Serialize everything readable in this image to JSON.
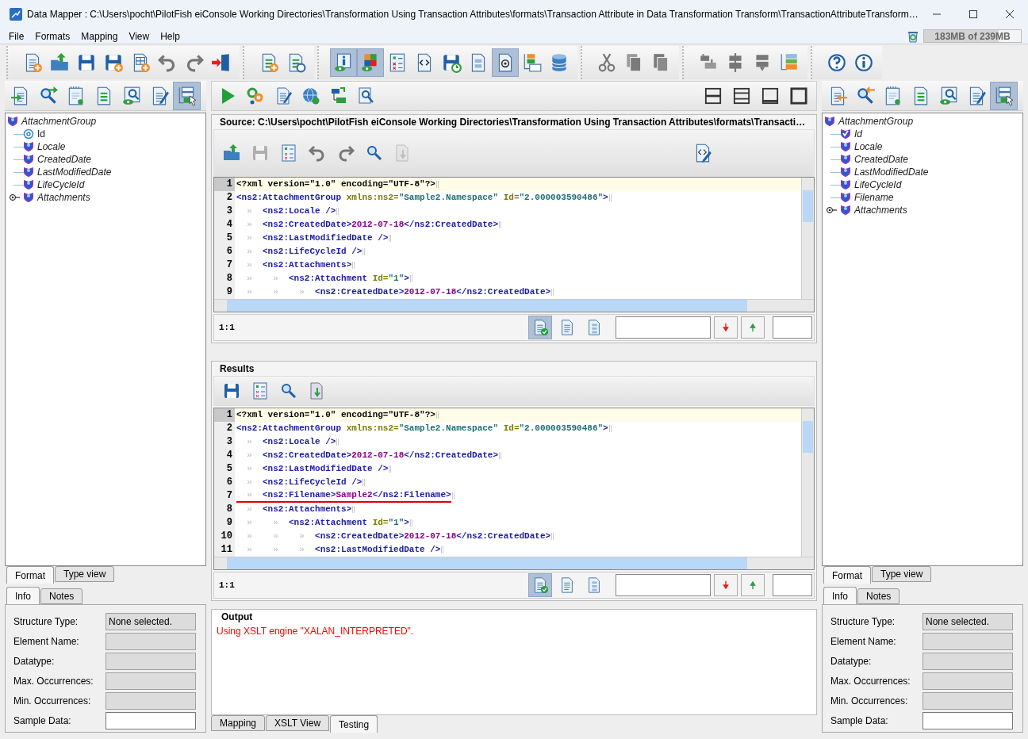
{
  "window": {
    "title": "Data Mapper : C:\\Users\\pocht\\PilotFish eiConsole Working Directories\\Transformation Using Transaction Attributes\\formats\\Transaction Attribute in Data Transformation Transform\\TransactionAttributeTransform…"
  },
  "menu": [
    "File",
    "Formats",
    "Mapping",
    "View",
    "Help"
  ],
  "memory": {
    "text": "183MB of 239MB",
    "level": 0.77
  },
  "main_toolbar": [
    [
      {
        "kind": "addfile",
        "pressed": false
      },
      {
        "kind": "openfolder",
        "pressed": false
      },
      {
        "kind": "save",
        "pressed": false
      },
      {
        "kind": "saveplus",
        "pressed": false
      },
      {
        "kind": "xls",
        "pressed": false
      },
      {
        "kind": "undo",
        "pressed": false
      },
      {
        "kind": "redo",
        "pressed": false
      },
      {
        "kind": "exit",
        "pressed": false
      }
    ],
    [
      {
        "kind": "listplus",
        "pressed": false
      },
      {
        "kind": "listgear",
        "pressed": false
      }
    ],
    [
      {
        "kind": "infoeye",
        "pressed": true
      },
      {
        "kind": "gridview",
        "pressed": true
      },
      {
        "kind": "checklist",
        "pressed": false
      },
      {
        "kind": "codedoc",
        "pressed": false
      },
      {
        "kind": "saveclock",
        "pressed": false
      },
      {
        "kind": "calcdoc",
        "pressed": false
      },
      {
        "kind": "atdoc",
        "pressed": true
      },
      {
        "kind": "treetable",
        "pressed": false
      },
      {
        "kind": "database",
        "pressed": false
      }
    ],
    [
      {
        "kind": "scissors",
        "pressed": false
      },
      {
        "kind": "copy",
        "pressed": false
      },
      {
        "kind": "paste",
        "pressed": false
      }
    ],
    [
      {
        "kind": "stackup",
        "pressed": false
      },
      {
        "kind": "stackmid",
        "pressed": false
      },
      {
        "kind": "stackdown",
        "pressed": false
      },
      {
        "kind": "colorstack",
        "pressed": false
      }
    ],
    [
      {
        "kind": "help",
        "pressed": false
      },
      {
        "kind": "info",
        "pressed": false
      }
    ]
  ],
  "left_panel": {
    "toolbar": [
      {
        "kind": "importdoc",
        "pressed": false
      },
      {
        "kind": "findmove",
        "pressed": false
      },
      {
        "kind": "notepad",
        "pressed": false
      },
      {
        "kind": "listdoc",
        "pressed": false
      },
      {
        "kind": "eyesearch",
        "pressed": false
      },
      {
        "kind": "editdoc",
        "pressed": false
      },
      {
        "kind": "treecursor",
        "pressed": true
      }
    ],
    "tree": {
      "label": "AttachmentGroup",
      "kind": "element",
      "children": [
        {
          "label": "Id",
          "kind": "attribute"
        },
        {
          "label": "Locale",
          "kind": "element"
        },
        {
          "label": "CreatedDate",
          "kind": "element"
        },
        {
          "label": "LastModifiedDate",
          "kind": "element"
        },
        {
          "label": "LifeCycleId",
          "kind": "element"
        },
        {
          "label": "Attachments",
          "kind": "element",
          "expanded": false
        }
      ]
    },
    "view_tabs": [
      {
        "label": "Format",
        "selected": true
      },
      {
        "label": "Type view",
        "selected": false
      }
    ],
    "info_tabs": [
      {
        "label": "Info",
        "selected": true
      },
      {
        "label": "Notes",
        "selected": false
      }
    ],
    "fields": [
      {
        "label": "Structure Type:",
        "value": "None selected.",
        "disabled": true
      },
      {
        "label": "Element Name:",
        "disabled": true
      },
      {
        "label": "Datatype:",
        "disabled": true
      },
      {
        "label": "Max. Occurrences:",
        "disabled": true
      },
      {
        "label": "Min. Occurrences:",
        "disabled": true
      },
      {
        "label": "Sample Data:",
        "disabled": false
      }
    ]
  },
  "center": {
    "toolbar": [
      {
        "kind": "play",
        "pressed": false
      },
      {
        "kind": "gears",
        "pressed": false
      },
      {
        "kind": "editdoc",
        "pressed": false
      },
      {
        "kind": "globe",
        "pressed": false
      },
      {
        "kind": "treearrow",
        "pressed": false
      },
      {
        "kind": "searchdoc",
        "pressed": false
      }
    ],
    "layout_toolbar": [
      {
        "kind": "splith",
        "pressed": false
      },
      {
        "kind": "splitrows",
        "pressed": false
      },
      {
        "kind": "framebottom",
        "pressed": false
      },
      {
        "kind": "framefull",
        "pressed": false
      }
    ],
    "source": {
      "title": "Source: C:\\Users\\pocht\\PilotFish eiConsole Working Directories\\Transformation Using Transaction Attributes\\formats\\Transacti…",
      "toolbar": [
        {
          "kind": "openfolder",
          "disabled": false
        },
        {
          "kind": "save",
          "disabled": true
        },
        {
          "kind": "checklist",
          "disabled": false
        },
        {
          "kind": "undo",
          "disabled": false
        },
        {
          "kind": "redo",
          "disabled": false
        },
        {
          "kind": "search",
          "disabled": false
        },
        {
          "kind": "docdown",
          "disabled": true
        }
      ],
      "lines": [
        {
          "number": "1",
          "current": true,
          "tokens": [
            {
              "kind": "pi",
              "text": "<?xml version=\"1.0\" encoding=\"UTF-8\"?>"
            }
          ]
        },
        {
          "number": "2",
          "current": false,
          "tokens": [
            {
              "kind": "tag",
              "text": "<ns2:AttachmentGroup"
            },
            {
              "kind": "attr",
              "text": " xmlns:ns2="
            },
            {
              "kind": "val",
              "text": "\"Sample2.Namespace\""
            },
            {
              "kind": "attr",
              "text": " Id="
            },
            {
              "kind": "val",
              "text": "\"2.000003590486\""
            },
            {
              "kind": "tag",
              "text": ">"
            }
          ]
        },
        {
          "number": "3",
          "current": false,
          "tokens": [
            {
              "kind": "ws",
              "text": "  »  "
            },
            {
              "kind": "tag",
              "text": "<ns2:Locale />"
            }
          ]
        },
        {
          "number": "4",
          "current": false,
          "tokens": [
            {
              "kind": "ws",
              "text": "  »  "
            },
            {
              "kind": "tag",
              "text": "<ns2:CreatedDate>"
            },
            {
              "kind": "text",
              "text": "2012-07-18"
            },
            {
              "kind": "tag",
              "text": "</ns2:CreatedDate>"
            }
          ]
        },
        {
          "number": "5",
          "current": false,
          "tokens": [
            {
              "kind": "ws",
              "text": "  »  "
            },
            {
              "kind": "tag",
              "text": "<ns2:LastModifiedDate />"
            }
          ]
        },
        {
          "number": "6",
          "current": false,
          "tokens": [
            {
              "kind": "ws",
              "text": "  »  "
            },
            {
              "kind": "tag",
              "text": "<ns2:LifeCycleId />"
            }
          ]
        },
        {
          "number": "7",
          "current": false,
          "tokens": [
            {
              "kind": "ws",
              "text": "  »  "
            },
            {
              "kind": "tag",
              "text": "<ns2:Attachments>"
            }
          ]
        },
        {
          "number": "8",
          "current": false,
          "tokens": [
            {
              "kind": "ws",
              "text": "  »    »  "
            },
            {
              "kind": "tag",
              "text": "<ns2:Attachment"
            },
            {
              "kind": "attr",
              "text": " Id="
            },
            {
              "kind": "val",
              "text": "\"1\""
            },
            {
              "kind": "tag",
              "text": ">"
            }
          ]
        },
        {
          "number": "9",
          "current": false,
          "tokens": [
            {
              "kind": "ws",
              "text": "  »    »    »  "
            },
            {
              "kind": "tag",
              "text": "<ns2:CreatedDate>"
            },
            {
              "kind": "text",
              "text": "2012-07-18"
            },
            {
              "kind": "tag",
              "text": "</ns2:CreatedDate>"
            }
          ]
        }
      ],
      "position": "1:1",
      "status_icons": [
        {
          "kind": "doccheck",
          "pressed": true
        },
        {
          "kind": "doclines",
          "pressed": false
        },
        {
          "kind": "doctree",
          "pressed": false
        }
      ],
      "code_button": {
        "kind": "codeedit"
      }
    },
    "results": {
      "title": "Results",
      "toolbar": [
        {
          "kind": "save",
          "disabled": false
        },
        {
          "kind": "checklist",
          "disabled": false
        },
        {
          "kind": "search",
          "disabled": false
        },
        {
          "kind": "docdown",
          "disabled": false
        }
      ],
      "lines": [
        {
          "number": "1",
          "current": true,
          "underlined": false,
          "tokens": [
            {
              "kind": "pi",
              "text": "<?xml version=\"1.0\" encoding=\"UTF-8\"?>"
            }
          ]
        },
        {
          "number": "2",
          "current": false,
          "underlined": false,
          "tokens": [
            {
              "kind": "tag",
              "text": "<ns2:AttachmentGroup"
            },
            {
              "kind": "attr",
              "text": " xmlns:ns2="
            },
            {
              "kind": "val",
              "text": "\"Sample2.Namespace\""
            },
            {
              "kind": "attr",
              "text": " Id="
            },
            {
              "kind": "val",
              "text": "\"2.000003590486\""
            },
            {
              "kind": "tag",
              "text": ">"
            }
          ]
        },
        {
          "number": "3",
          "current": false,
          "underlined": false,
          "tokens": [
            {
              "kind": "ws",
              "text": "  »  "
            },
            {
              "kind": "tag",
              "text": "<ns2:Locale />"
            }
          ]
        },
        {
          "number": "4",
          "current": false,
          "underlined": false,
          "tokens": [
            {
              "kind": "ws",
              "text": "  »  "
            },
            {
              "kind": "tag",
              "text": "<ns2:CreatedDate>"
            },
            {
              "kind": "text",
              "text": "2012-07-18"
            },
            {
              "kind": "tag",
              "text": "</ns2:CreatedDate>"
            }
          ]
        },
        {
          "number": "5",
          "current": false,
          "underlined": false,
          "tokens": [
            {
              "kind": "ws",
              "text": "  »  "
            },
            {
              "kind": "tag",
              "text": "<ns2:LastModifiedDate />"
            }
          ]
        },
        {
          "number": "6",
          "current": false,
          "underlined": false,
          "tokens": [
            {
              "kind": "ws",
              "text": "  »  "
            },
            {
              "kind": "tag",
              "text": "<ns2:LifeCycleId />"
            }
          ]
        },
        {
          "number": "7",
          "current": false,
          "underlined": true,
          "tokens": [
            {
              "kind": "ws",
              "text": "  »  "
            },
            {
              "kind": "tag",
              "text": "<ns2:Filename>"
            },
            {
              "kind": "text",
              "text": "Sample2"
            },
            {
              "kind": "tag",
              "text": "</ns2:Filename>"
            }
          ]
        },
        {
          "number": "8",
          "current": false,
          "underlined": false,
          "tokens": [
            {
              "kind": "ws",
              "text": "  »  "
            },
            {
              "kind": "tag",
              "text": "<ns2:Attachments>"
            }
          ]
        },
        {
          "number": "9",
          "current": false,
          "underlined": false,
          "tokens": [
            {
              "kind": "ws",
              "text": "  »    »  "
            },
            {
              "kind": "tag",
              "text": "<ns2:Attachment"
            },
            {
              "kind": "attr",
              "text": " Id="
            },
            {
              "kind": "val",
              "text": "\"1\""
            },
            {
              "kind": "tag",
              "text": ">"
            }
          ]
        },
        {
          "number": "10",
          "current": false,
          "underlined": false,
          "tokens": [
            {
              "kind": "ws",
              "text": "  »    »    »  "
            },
            {
              "kind": "tag",
              "text": "<ns2:CreatedDate>"
            },
            {
              "kind": "text",
              "text": "2012-07-18"
            },
            {
              "kind": "tag",
              "text": "</ns2:CreatedDate>"
            }
          ]
        },
        {
          "number": "11",
          "current": false,
          "underlined": false,
          "tokens": [
            {
              "kind": "ws",
              "text": "  »    »    »  "
            },
            {
              "kind": "tag",
              "text": "<ns2:LastModifiedDate />"
            }
          ]
        }
      ],
      "position": "1:1",
      "status_icons": [
        {
          "kind": "doccheck",
          "pressed": true
        },
        {
          "kind": "doclines",
          "pressed": false
        },
        {
          "kind": "doctree",
          "pressed": false
        }
      ]
    },
    "output": {
      "title": "Output",
      "message": "Using XSLT engine \"XALAN_INTERPRETED\"."
    },
    "bottom_tabs": [
      {
        "label": "Mapping",
        "selected": false
      },
      {
        "label": "XSLT View",
        "selected": false
      },
      {
        "label": "Testing",
        "selected": true
      }
    ]
  },
  "right_panel": {
    "toolbar": [
      {
        "kind": "exportdoc",
        "pressed": false
      },
      {
        "kind": "findback",
        "pressed": false
      },
      {
        "kind": "notepad",
        "pressed": false
      },
      {
        "kind": "listdoc",
        "pressed": false
      },
      {
        "kind": "eyesearch",
        "pressed": false
      },
      {
        "kind": "editdoc",
        "pressed": false
      },
      {
        "kind": "treecursor",
        "pressed": true
      }
    ],
    "tree": {
      "label": "AttachmentGroup",
      "kind": "element",
      "children": [
        {
          "label": "Id",
          "kind": "keyelement"
        },
        {
          "label": "Locale",
          "kind": "element"
        },
        {
          "label": "CreatedDate",
          "kind": "element"
        },
        {
          "label": "LastModifiedDate",
          "kind": "element"
        },
        {
          "label": "LifeCycleId",
          "kind": "element"
        },
        {
          "label": "Filename",
          "kind": "element"
        },
        {
          "label": "Attachments",
          "kind": "element",
          "expanded": false
        }
      ]
    },
    "view_tabs": [
      {
        "label": "Format",
        "selected": true
      },
      {
        "label": "Type view",
        "selected": false
      }
    ],
    "info_tabs": [
      {
        "label": "Info",
        "selected": true
      },
      {
        "label": "Notes",
        "selected": false
      }
    ],
    "fields": [
      {
        "label": "Structure Type:",
        "value": "None selected.",
        "disabled": true
      },
      {
        "label": "Element Name:",
        "disabled": true
      },
      {
        "label": "Datatype:",
        "disabled": true
      },
      {
        "label": "Max. Occurrences:",
        "disabled": true
      },
      {
        "label": "Min. Occurrences:",
        "disabled": true
      },
      {
        "label": "Sample Data:",
        "disabled": false
      }
    ]
  }
}
